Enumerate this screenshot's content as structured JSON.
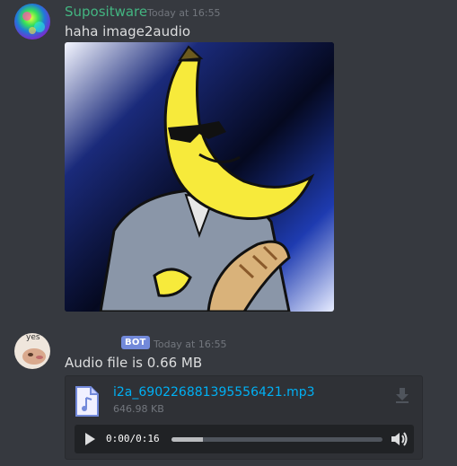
{
  "messages": [
    {
      "author": "Supositware",
      "author_color": "#43b581",
      "timestamp": "Today at 16:55",
      "text": "haha image2audio",
      "attachment": {
        "type": "image",
        "description": "banana-man-sunglasses-suit-baguette"
      }
    },
    {
      "author": "",
      "author_color": "#ffffff",
      "avatar_text": "yes",
      "badge": "BOT",
      "timestamp": "Today at 16:55",
      "text": "Audio file is 0.66 MB",
      "attachment": {
        "type": "audio",
        "filename": "i2a_690226881395556421.mp3",
        "filesize": "646.98 KB",
        "player": {
          "current_time": "0:00",
          "separator": "/",
          "duration": "0:16",
          "buffered_fraction": 0.15
        },
        "icons": {
          "file": "audio-file-icon",
          "download": "download-icon",
          "play": "play-icon",
          "volume": "volume-icon"
        }
      }
    }
  ],
  "colors": {
    "background": "#36393f",
    "link": "#00b0f4",
    "badge": "#7289da"
  }
}
